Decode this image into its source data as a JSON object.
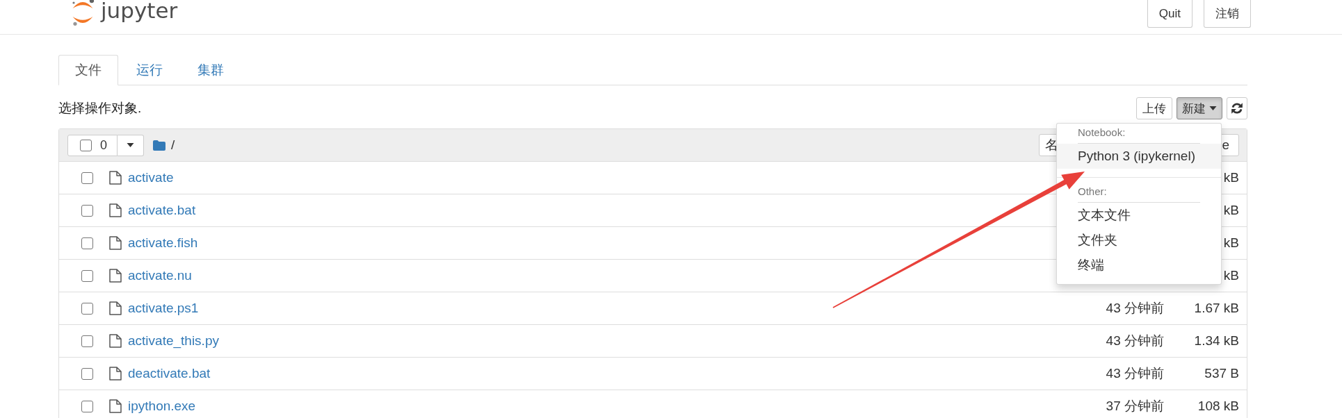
{
  "header": {
    "logo_text": "jupyter",
    "buttons": [
      {
        "label": "Quit"
      },
      {
        "label": "注销"
      }
    ]
  },
  "tabs": [
    {
      "label": "文件",
      "selected": true
    },
    {
      "label": "运行",
      "selected": false
    },
    {
      "label": "集群",
      "selected": false
    }
  ],
  "toolbar": {
    "hint": "选择操作对象.",
    "upload_button": {
      "label": "上传"
    },
    "new_button": {
      "label": "新建",
      "open": true
    },
    "new_menu": {
      "sections": [
        {
          "header": "Notebook:",
          "items": [
            {
              "label": "Python 3 (ipykernel)",
              "highlighted": true
            }
          ]
        },
        {
          "header": "Other:",
          "items": [
            {
              "label": "文本文件",
              "highlighted": false
            },
            {
              "label": "文件夹",
              "highlighted": false
            },
            {
              "label": "终端",
              "highlighted": false
            }
          ]
        }
      ]
    }
  },
  "file_list": {
    "select_all": {
      "checked": false,
      "count": "0"
    },
    "path": "/",
    "sort_buttons": [
      {
        "label": "名"
      },
      {
        "label": "e"
      }
    ],
    "rows": [
      {
        "name": "activate",
        "checked": false,
        "size": "kB"
      },
      {
        "name": "activate.bat",
        "checked": false,
        "size": "kB"
      },
      {
        "name": "activate.fish",
        "checked": false,
        "size": "kB"
      },
      {
        "name": "activate.nu",
        "checked": false,
        "size": "kB"
      },
      {
        "name": "activate.ps1",
        "checked": false,
        "modified": "43 分钟前",
        "size": "1.67 kB"
      },
      {
        "name": "activate_this.py",
        "checked": false,
        "modified": "43 分钟前",
        "size": "1.34 kB"
      },
      {
        "name": "deactivate.bat",
        "checked": false,
        "modified": "43 分钟前",
        "size": "537 B"
      },
      {
        "name": "ipython.exe",
        "checked": false,
        "modified": "37 分钟前",
        "size": "108 kB"
      }
    ]
  }
}
